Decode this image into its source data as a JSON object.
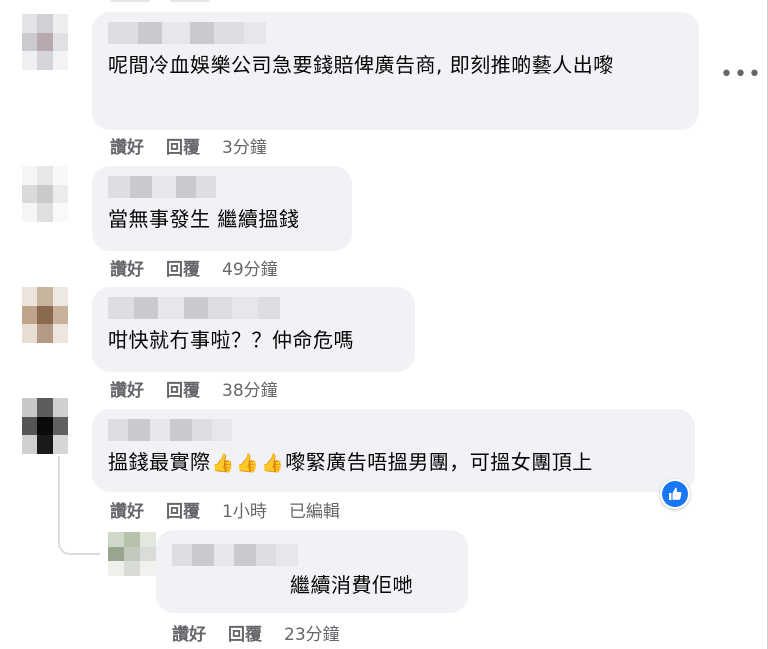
{
  "top_fragment": {
    "icon": "blurred-text"
  },
  "comments": [
    {
      "text": "呢間冷血娛樂公司急要錢賠俾廣告商, 即刻推啲藝人出嚟",
      "actions": {
        "like": "讚好",
        "reply": "回覆",
        "time": "3分鐘"
      }
    },
    {
      "text": "當無事發生 繼續搵錢",
      "actions": {
        "like": "讚好",
        "reply": "回覆",
        "time": "49分鐘"
      }
    },
    {
      "text": "咁快就冇事啦？？仲命危嗎",
      "actions": {
        "like": "讚好",
        "reply": "回覆",
        "time": "38分鐘"
      }
    },
    {
      "text_before": "搵錢最實際",
      "emoji": [
        "👍",
        "👍",
        "👍"
      ],
      "text_after": "嚟緊廣告唔搵男團，可搵女團頂上",
      "actions": {
        "like": "讚好",
        "reply": "回覆",
        "time": "1小時",
        "edited": "已編輯"
      },
      "reaction": {
        "icon": "thumbs-up-icon",
        "color": "#1877f2"
      }
    }
  ],
  "reply": {
    "text": "繼續消費佢哋",
    "actions": {
      "like": "讚好",
      "reply": "回覆",
      "time": "23分鐘"
    }
  },
  "more_menu": {
    "icon": "more-options-icon",
    "glyph": "•••"
  }
}
